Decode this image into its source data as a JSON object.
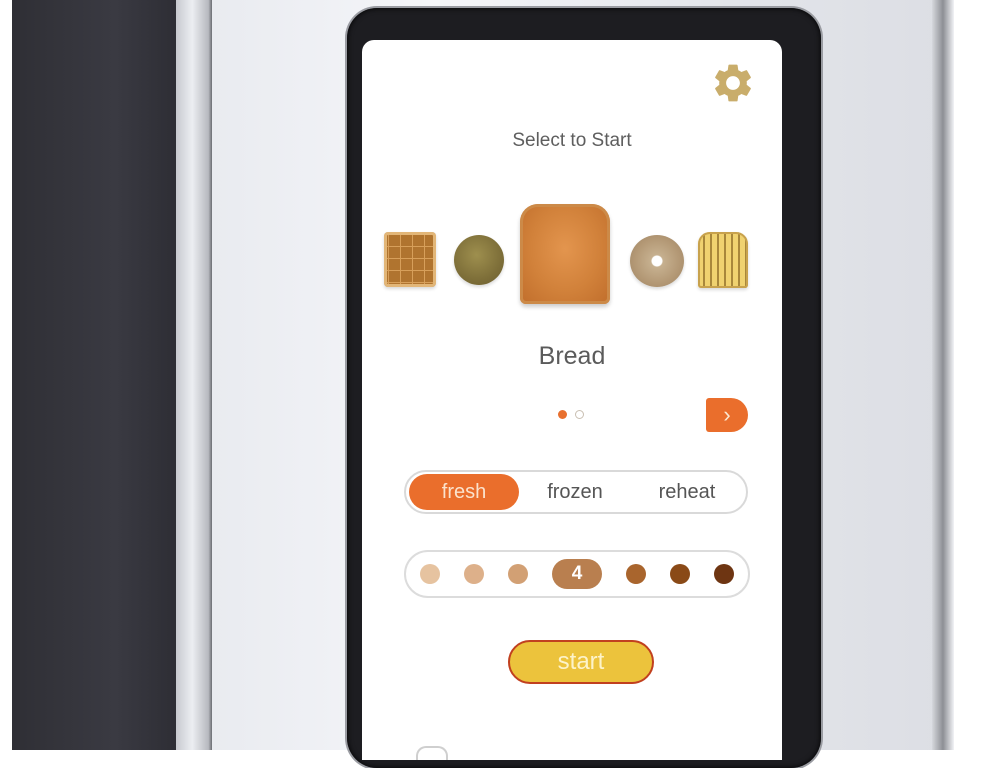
{
  "device": {
    "type": "toaster touchscreen"
  },
  "screen": {
    "settings_icon": "gear-icon",
    "title": "Select to Start",
    "food_items": [
      {
        "id": "waffle",
        "name": "Waffle",
        "selected": false
      },
      {
        "id": "muffin",
        "name": "English Muffin",
        "selected": false
      },
      {
        "id": "bread",
        "name": "Bread",
        "selected": true
      },
      {
        "id": "bagel",
        "name": "Bagel",
        "selected": false
      },
      {
        "id": "toast2",
        "name": "Toaster Pastry",
        "selected": false
      }
    ],
    "selected_food_label": "Bread",
    "pager": {
      "current_page": 1,
      "total_pages": 2
    },
    "next_icon": "chevron-right-icon",
    "next_glyph": "›",
    "modes": [
      {
        "label": "fresh",
        "selected": true
      },
      {
        "label": "frozen",
        "selected": false
      },
      {
        "label": "reheat",
        "selected": false
      }
    ],
    "shade": {
      "levels": 7,
      "selected_level": 4,
      "selected_label": "4",
      "colors": [
        "#e6c3a0",
        "#ddb08a",
        "#d2a074",
        "#b97f4f",
        "#a9652d",
        "#8a4a17",
        "#6e3512"
      ]
    },
    "start_label": "start",
    "colors": {
      "accent_orange": "#ea6e2c",
      "settings_gold": "#c9ad6b",
      "start_yellow": "#ecc33c",
      "start_border": "#c1401f",
      "text_gray": "#5e5e5e"
    }
  }
}
